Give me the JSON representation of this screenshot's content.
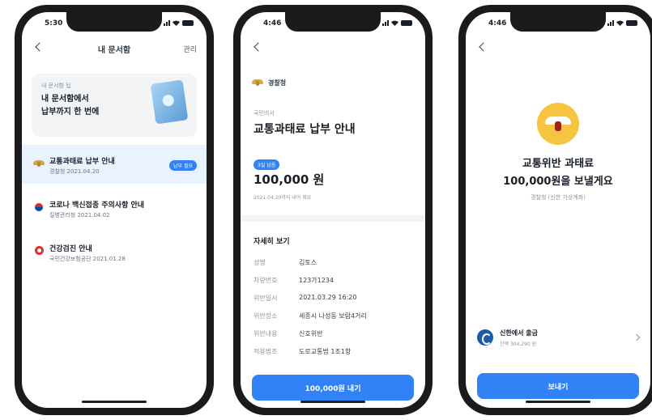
{
  "phone1": {
    "time": "5:30",
    "title": "내 문서함",
    "manage": "관리",
    "tip": {
      "label": "내 문서함 팁",
      "text": "내 문서함에서\n납부까지 한 번에"
    },
    "documents": [
      {
        "title": "교통과태료 납부 안내",
        "sub": "경찰청 2021.04.20",
        "badge": "납부 필요",
        "icon": "police-emblem-icon"
      },
      {
        "title": "코로나 백신접종 주의사항 안내",
        "sub": "질병관리청 2021.04.02",
        "icon": "taegeuk-icon"
      },
      {
        "title": "건강검진 안내",
        "sub": "국민건강보험공단 2021.01.28",
        "icon": "nhis-icon"
      }
    ]
  },
  "phone2": {
    "time": "4:46",
    "agency": "경찰청",
    "label": "국민비서",
    "title": "교통과태료 납부 안내",
    "due_badge": "3일 남음",
    "amount": "100,000 원",
    "due_text": "2021.04.20까지 내야 해요",
    "detail_header": "자세히 보기",
    "details": [
      {
        "k": "성명",
        "v": "김토스"
      },
      {
        "k": "차량번호",
        "v": "123가1234"
      },
      {
        "k": "위반일시",
        "v": "2021.03.29 16:20"
      },
      {
        "k": "위반장소",
        "v": "세종시 나성동 보람4거리"
      },
      {
        "k": "위반내용",
        "v": "신호위반"
      },
      {
        "k": "적용법조",
        "v": "도로교통법 1조1항"
      }
    ],
    "cta": "100,000원 내기"
  },
  "phone3": {
    "time": "4:46",
    "title": "교통위반 과태료\n100,000원을 보낼게요",
    "sub": "경찰청 (신한 가상계좌)",
    "bank_name": "신한에서 출금",
    "bank_balance": "잔액 304,290 원",
    "cta": "보내기"
  },
  "colors": {
    "accent": "#3182f6",
    "badge_bg": "#e8f3ff",
    "emblem": "#f5c542"
  }
}
